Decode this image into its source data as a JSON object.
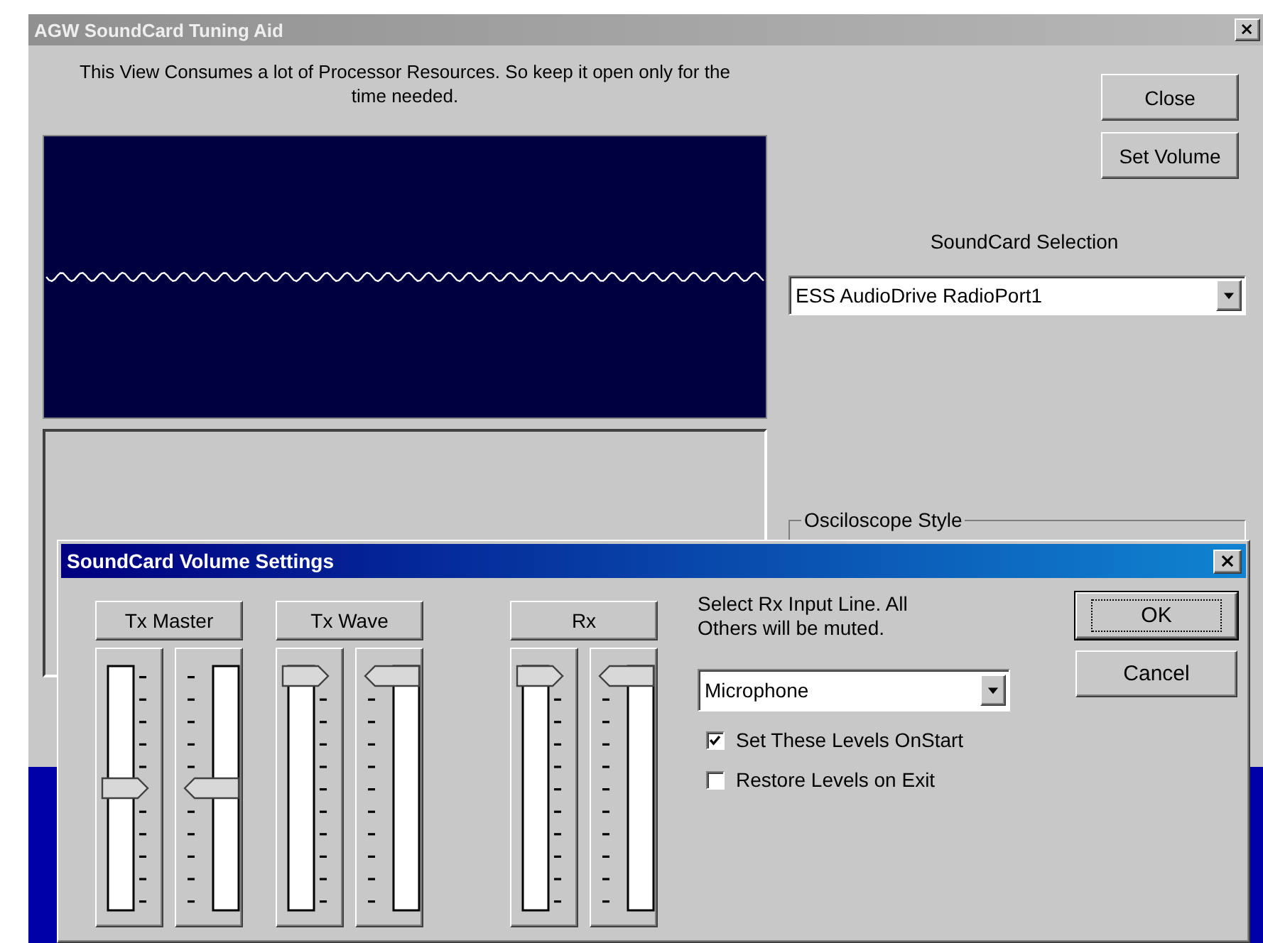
{
  "window": {
    "title": "AGW SoundCard Tuning Aid"
  },
  "notice": "This View Consumes a lot of Processor Resources. So keep it open only for the time needed.",
  "buttons": [
    "Close",
    "Set Volume"
  ],
  "soundcard": {
    "label": "SoundCard Selection",
    "value": "ESS AudioDrive RadioPort1"
  },
  "scope_style": {
    "label": "Osciloscope Style"
  },
  "dialog": {
    "title": "SoundCard Volume Settings",
    "groups": [
      {
        "label": "Tx Master",
        "sliders": [
          {
            "level": 0.5
          },
          {
            "level": 0.5
          }
        ]
      },
      {
        "label": "Tx Wave",
        "sliders": [
          {
            "level": 1
          },
          {
            "level": 1
          }
        ]
      },
      {
        "label": "Rx",
        "sliders": [
          {
            "level": 1
          },
          {
            "level": 1
          }
        ]
      }
    ],
    "rx_prompt": "Select Rx Input Line. All Others will be muted.",
    "rx_input": {
      "value": "Microphone"
    },
    "options": [
      {
        "label": "Set These Levels OnStart",
        "checked": true
      },
      {
        "label": "Restore Levels on Exit",
        "checked": false
      }
    ],
    "buttons": [
      {
        "label": "OK",
        "default": true
      },
      {
        "label": "Cancel",
        "default": false
      }
    ]
  }
}
